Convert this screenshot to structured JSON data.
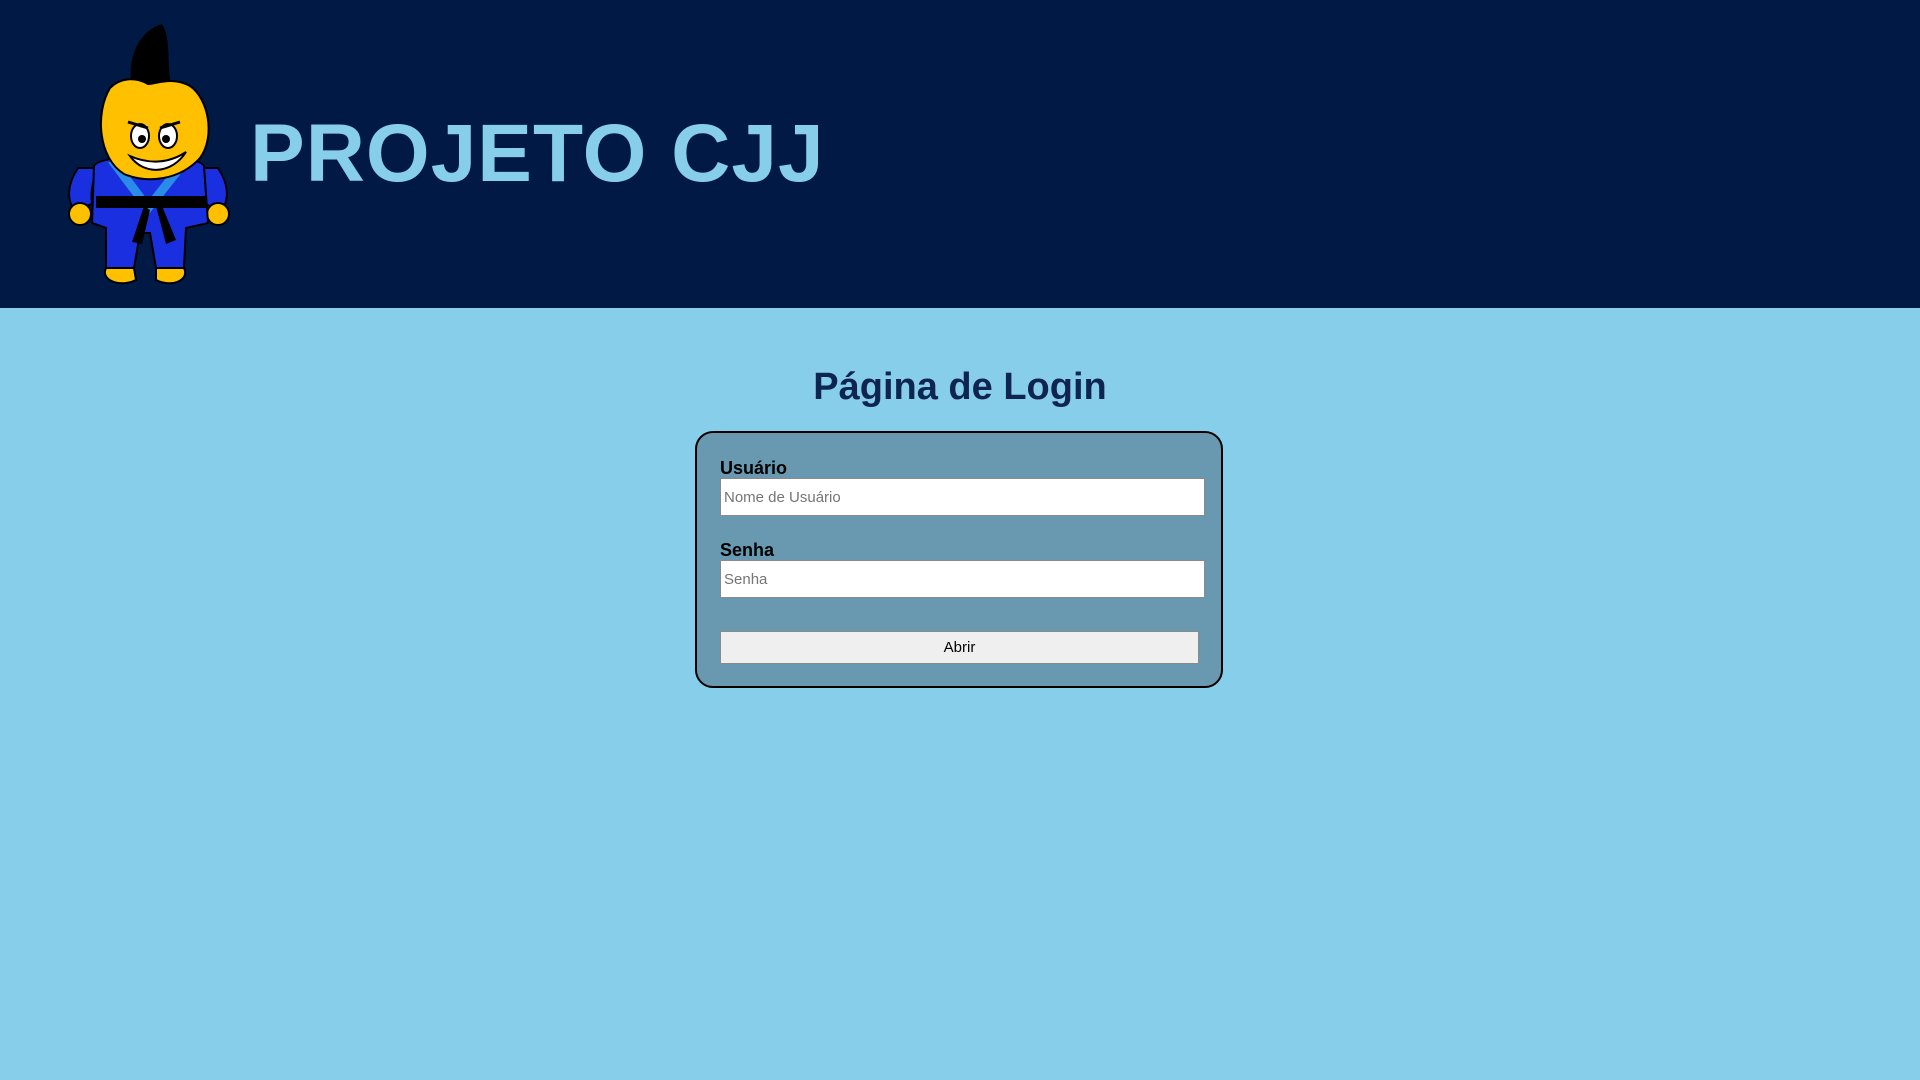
{
  "header": {
    "title": "PROJETO CJJ",
    "logo_icon": "judoka-mascot-icon",
    "background_color": "#001a45",
    "title_color": "#87ceeb"
  },
  "main": {
    "heading": "Página de Login",
    "background_color": "#87ceeb"
  },
  "login_form": {
    "username_label": "Usuário",
    "username_placeholder": "Nome de Usuário",
    "username_value": "",
    "password_label": "Senha",
    "password_placeholder": "Senha",
    "password_value": "",
    "submit_label": "Abrir",
    "box_color": "#6899b0"
  }
}
